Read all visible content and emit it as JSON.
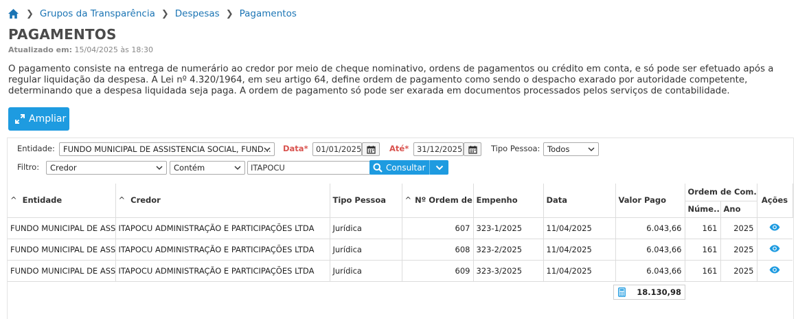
{
  "breadcrumb": {
    "home_icon": "home-icon",
    "items": [
      "Grupos da Transparência",
      "Despesas",
      "Pagamentos"
    ]
  },
  "page": {
    "title": "PAGAMENTOS",
    "updated_label": "Atualizado em:",
    "updated_value": "15/04/2025 às 18:30",
    "description": "O pagamento consiste na entrega de numerário ao credor por meio de cheque nominativo, ordens de pagamentos ou crédito em conta, e só pode ser efetuado após a regular liquidação da despesa. A Lei nº 4.320/1964, em seu artigo 64, define ordem de pagamento como sendo o despacho exarado por autoridade competente, determinando que a despesa liquidada seja paga. A ordem de pagamento só pode ser exarada em documentos processados pelos serviços de contabilidade."
  },
  "toolbar": {
    "expand_label": "Ampliar"
  },
  "filters": {
    "entidade_label": "Entidade:",
    "entidade_value": "FUNDO MUNICIPAL DE ASSISTENCIA SOCIAL, FUND...",
    "data_label": "Data*",
    "data_value": "01/01/2025",
    "ate_label": "Até*",
    "ate_value": "31/12/2025",
    "tipo_pessoa_label": "Tipo Pessoa:",
    "tipo_pessoa_value": "Todos",
    "filtro_label": "Filtro:",
    "filtro_field": "Credor",
    "filtro_operator": "Contém",
    "filtro_text": "ITAPOCU",
    "consultar_label": "Consultar"
  },
  "table": {
    "headers": {
      "entidade": "Entidade",
      "credor": "Credor",
      "tipo_pessoa": "Tipo Pessoa",
      "ordem": "Nº Ordem de...",
      "empenho": "Empenho",
      "data": "Data",
      "valor_pago": "Valor Pago",
      "ordem_compra": "Ordem de Com...",
      "numero": "Núme...",
      "ano": "Ano",
      "acoes": "Ações"
    },
    "rows": [
      {
        "entidade": "FUNDO MUNICIPAL DE ASSISTENCIA SOCIAL",
        "credor": "ITAPOCU ADMINISTRAÇÃO E PARTICIPAÇÕES LTDA",
        "tipo_pessoa": "Jurídica",
        "ordem": "607",
        "empenho": "323-1/2025",
        "data": "11/04/2025",
        "valor_pago": "6.043,66",
        "numero": "161",
        "ano": "2025"
      },
      {
        "entidade": "FUNDO MUNICIPAL DE ASSISTENCIA SOCIAL",
        "credor": "ITAPOCU ADMINISTRAÇÃO E PARTICIPAÇÕES LTDA",
        "tipo_pessoa": "Jurídica",
        "ordem": "608",
        "empenho": "323-2/2025",
        "data": "11/04/2025",
        "valor_pago": "6.043,66",
        "numero": "161",
        "ano": "2025"
      },
      {
        "entidade": "FUNDO MUNICIPAL DE ASSISTENCIA SOCIAL",
        "credor": "ITAPOCU ADMINISTRAÇÃO E PARTICIPAÇÕES LTDA",
        "tipo_pessoa": "Jurídica",
        "ordem": "609",
        "empenho": "323-3/2025",
        "data": "11/04/2025",
        "valor_pago": "6.043,66",
        "numero": "161",
        "ano": "2025"
      }
    ],
    "total_icon": "calculator-icon",
    "total": "18.130,98",
    "action_icon": "eye-icon"
  },
  "colors": {
    "accent": "#1e9be0",
    "link": "#1a74b4",
    "required": "#d9534f"
  }
}
